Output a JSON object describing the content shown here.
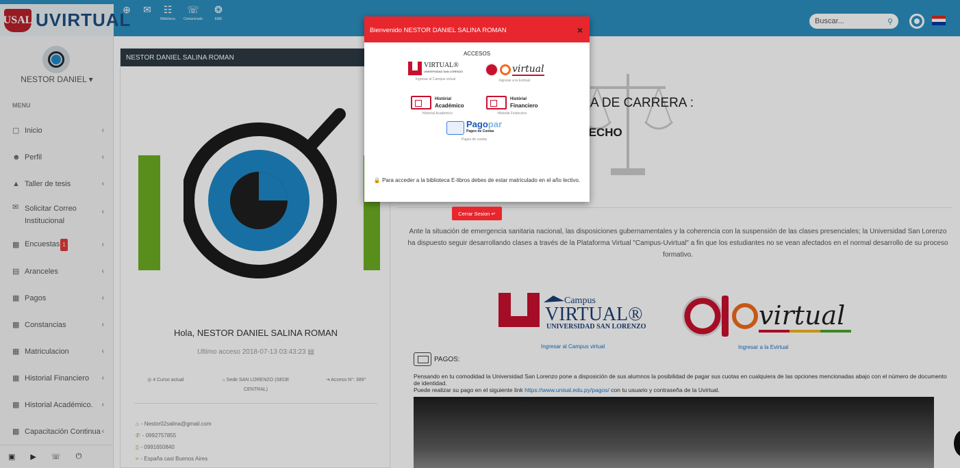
{
  "app": {
    "logo_text": "UVIRTUAL",
    "logo_shield_text": "USAL"
  },
  "topbar": {
    "icons": [
      {
        "icon": "plus-circle-icon",
        "label": ""
      },
      {
        "icon": "mail-icon",
        "label": ""
      },
      {
        "icon": "biblioteca-icon",
        "label": "Biblioteca"
      },
      {
        "icon": "comunicado-icon",
        "label": "Comunicado"
      },
      {
        "icon": "eme-icon",
        "label": "EME"
      }
    ],
    "search_placeholder": "Buscar...",
    "colors": {
      "bar": "#2d8fc0",
      "accent": "#e8262e"
    }
  },
  "sidebar": {
    "user_name": "NESTOR DANIEL ▾",
    "menu_header": "MENU",
    "items": [
      {
        "icon": "monitor-icon",
        "label": "Inicio"
      },
      {
        "icon": "users-icon",
        "label": "Perfil"
      },
      {
        "icon": "graduation-cap-icon",
        "label": "Taller de tesis"
      },
      {
        "icon": "mail-icon",
        "label": "Solicitar Correo Institucional"
      },
      {
        "icon": "chart-icon",
        "label": "Encuestas",
        "badge": "1"
      },
      {
        "icon": "clipboard-icon",
        "label": "Aranceles"
      },
      {
        "icon": "money-icon",
        "label": "Pagos"
      },
      {
        "icon": "file-icon",
        "label": "Constancias"
      },
      {
        "icon": "id-card-icon",
        "label": "Matriculacion"
      },
      {
        "icon": "money-icon",
        "label": "Historial Financiero"
      },
      {
        "icon": "file-icon",
        "label": "Historial Académico."
      },
      {
        "icon": "file-icon",
        "label": "Capacitación Continua"
      }
    ],
    "footer_icons": [
      "facebook-icon",
      "youtube-icon",
      "whatsapp-icon",
      "power-icon"
    ]
  },
  "profile": {
    "header": "NESTOR DANIEL SALINA ROMAN",
    "greeting": "Hola, NESTOR DANIEL SALINA ROMAN",
    "last_access": "Ultimo acceso 2018-07-13 03:43:23 ▤",
    "curso": "◎ 4 Curso actual",
    "sede": "⌂ Sede SAN LORENZO (SEDE CENTRAL)",
    "acceso": "⇥ Acceso N°: 389°",
    "email": "- Nestor02salina@gmail.com",
    "phone": "- 0992757855",
    "mobile": "- 0991650840",
    "address": "- España casi Buenos Aires"
  },
  "main": {
    "carrera_label": "A DE CARRERA :",
    "carrera_name": "ERECHO",
    "notice": "Ante la situación de emergencia sanitaria nacional, las disposiciones gubernamentales y la coherencia con la suspensión de las clases presenciales; la Universidad San Lorenzo ha dispuesto seguir desarrollando clases a través de la Plataforma Virtual \"Campus-Uvirtual\" a fin que los estudiantes no se vean afectados en el normal desarrollo de su proceso formativo.",
    "campus_logo_lines": [
      "Campus",
      "VIRTUAL®",
      "UNIVERSIDAD SAN LORENZO"
    ],
    "campus_link": "Ingresar al Campus virtual",
    "evirtual_logo_text": "virtual",
    "evirtual_link": "Ingresar a la Evirtual",
    "pagos_title": "PAGOS:",
    "pagos_text_1": "Pensando en tu comodidad la Universidad San Lorenzo pone a disposición de sus alumnos la posibilidad de pagar sus cuotas en cualquiera de las opciones mencionadas abajo con el número de documento de identidad.",
    "pagos_text_2": "Puede realizar su pago en el siguiente link",
    "pagos_link": "https://www.unisal.edu.py/pagos/",
    "pagos_text_3": "con tu usuario y contraseña de la Uvirtual."
  },
  "modal": {
    "title": "Bienvenido NESTOR DANIEL SALINA ROMAN",
    "close": "×",
    "section": "ACCESOS",
    "campus_caption": "Ingresar al Campus virtual",
    "campus_word": "VIRTUAL®",
    "campus_small": "UNIVERSIDAD SAN LORENZO",
    "evirtual_caption": "Ingresar a la Evirtual",
    "evirtual_word": "virtual",
    "hist_acad_label": "Histórial",
    "hist_acad_word": "Académico",
    "hist_acad_caption": "Historial Academico",
    "hist_fin_label": "Histórial",
    "hist_fin_word": "Financiero",
    "hist_fin_caption": "Historial Financiero",
    "pagopar_word_a": "Pago",
    "pagopar_word_b": "par",
    "pagopar_sub": "Pagos de Cuotas",
    "pagopar_caption": "Pagos de cuotas",
    "warning": "Para acceder a la biblioteca E-libros debes de estar matriculado en el año lectivo.",
    "logout_label": "Cerrar Sesion ↵"
  }
}
